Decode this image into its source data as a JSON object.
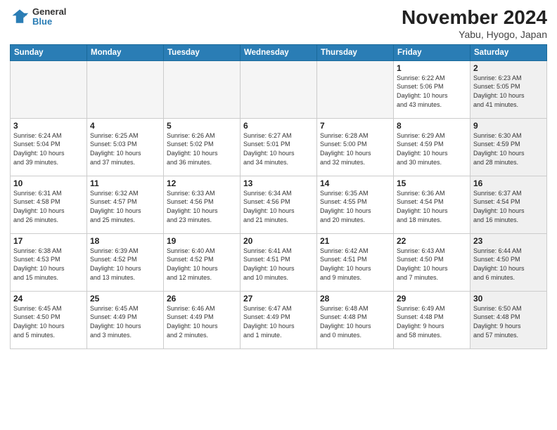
{
  "header": {
    "logo_line1": "General",
    "logo_line2": "Blue",
    "title": "November 2024",
    "subtitle": "Yabu, Hyogo, Japan"
  },
  "weekdays": [
    "Sunday",
    "Monday",
    "Tuesday",
    "Wednesday",
    "Thursday",
    "Friday",
    "Saturday"
  ],
  "weeks": [
    [
      {
        "day": "",
        "info": "",
        "empty": true
      },
      {
        "day": "",
        "info": "",
        "empty": true
      },
      {
        "day": "",
        "info": "",
        "empty": true
      },
      {
        "day": "",
        "info": "",
        "empty": true
      },
      {
        "day": "",
        "info": "",
        "empty": true
      },
      {
        "day": "1",
        "info": "Sunrise: 6:22 AM\nSunset: 5:06 PM\nDaylight: 10 hours\nand 43 minutes.",
        "shaded": false
      },
      {
        "day": "2",
        "info": "Sunrise: 6:23 AM\nSunset: 5:05 PM\nDaylight: 10 hours\nand 41 minutes.",
        "shaded": true
      }
    ],
    [
      {
        "day": "3",
        "info": "Sunrise: 6:24 AM\nSunset: 5:04 PM\nDaylight: 10 hours\nand 39 minutes.",
        "shaded": false
      },
      {
        "day": "4",
        "info": "Sunrise: 6:25 AM\nSunset: 5:03 PM\nDaylight: 10 hours\nand 37 minutes.",
        "shaded": false
      },
      {
        "day": "5",
        "info": "Sunrise: 6:26 AM\nSunset: 5:02 PM\nDaylight: 10 hours\nand 36 minutes.",
        "shaded": false
      },
      {
        "day": "6",
        "info": "Sunrise: 6:27 AM\nSunset: 5:01 PM\nDaylight: 10 hours\nand 34 minutes.",
        "shaded": false
      },
      {
        "day": "7",
        "info": "Sunrise: 6:28 AM\nSunset: 5:00 PM\nDaylight: 10 hours\nand 32 minutes.",
        "shaded": false
      },
      {
        "day": "8",
        "info": "Sunrise: 6:29 AM\nSunset: 4:59 PM\nDaylight: 10 hours\nand 30 minutes.",
        "shaded": false
      },
      {
        "day": "9",
        "info": "Sunrise: 6:30 AM\nSunset: 4:59 PM\nDaylight: 10 hours\nand 28 minutes.",
        "shaded": true
      }
    ],
    [
      {
        "day": "10",
        "info": "Sunrise: 6:31 AM\nSunset: 4:58 PM\nDaylight: 10 hours\nand 26 minutes.",
        "shaded": false
      },
      {
        "day": "11",
        "info": "Sunrise: 6:32 AM\nSunset: 4:57 PM\nDaylight: 10 hours\nand 25 minutes.",
        "shaded": false
      },
      {
        "day": "12",
        "info": "Sunrise: 6:33 AM\nSunset: 4:56 PM\nDaylight: 10 hours\nand 23 minutes.",
        "shaded": false
      },
      {
        "day": "13",
        "info": "Sunrise: 6:34 AM\nSunset: 4:56 PM\nDaylight: 10 hours\nand 21 minutes.",
        "shaded": false
      },
      {
        "day": "14",
        "info": "Sunrise: 6:35 AM\nSunset: 4:55 PM\nDaylight: 10 hours\nand 20 minutes.",
        "shaded": false
      },
      {
        "day": "15",
        "info": "Sunrise: 6:36 AM\nSunset: 4:54 PM\nDaylight: 10 hours\nand 18 minutes.",
        "shaded": false
      },
      {
        "day": "16",
        "info": "Sunrise: 6:37 AM\nSunset: 4:54 PM\nDaylight: 10 hours\nand 16 minutes.",
        "shaded": true
      }
    ],
    [
      {
        "day": "17",
        "info": "Sunrise: 6:38 AM\nSunset: 4:53 PM\nDaylight: 10 hours\nand 15 minutes.",
        "shaded": false
      },
      {
        "day": "18",
        "info": "Sunrise: 6:39 AM\nSunset: 4:52 PM\nDaylight: 10 hours\nand 13 minutes.",
        "shaded": false
      },
      {
        "day": "19",
        "info": "Sunrise: 6:40 AM\nSunset: 4:52 PM\nDaylight: 10 hours\nand 12 minutes.",
        "shaded": false
      },
      {
        "day": "20",
        "info": "Sunrise: 6:41 AM\nSunset: 4:51 PM\nDaylight: 10 hours\nand 10 minutes.",
        "shaded": false
      },
      {
        "day": "21",
        "info": "Sunrise: 6:42 AM\nSunset: 4:51 PM\nDaylight: 10 hours\nand 9 minutes.",
        "shaded": false
      },
      {
        "day": "22",
        "info": "Sunrise: 6:43 AM\nSunset: 4:50 PM\nDaylight: 10 hours\nand 7 minutes.",
        "shaded": false
      },
      {
        "day": "23",
        "info": "Sunrise: 6:44 AM\nSunset: 4:50 PM\nDaylight: 10 hours\nand 6 minutes.",
        "shaded": true
      }
    ],
    [
      {
        "day": "24",
        "info": "Sunrise: 6:45 AM\nSunset: 4:50 PM\nDaylight: 10 hours\nand 5 minutes.",
        "shaded": false
      },
      {
        "day": "25",
        "info": "Sunrise: 6:45 AM\nSunset: 4:49 PM\nDaylight: 10 hours\nand 3 minutes.",
        "shaded": false
      },
      {
        "day": "26",
        "info": "Sunrise: 6:46 AM\nSunset: 4:49 PM\nDaylight: 10 hours\nand 2 minutes.",
        "shaded": false
      },
      {
        "day": "27",
        "info": "Sunrise: 6:47 AM\nSunset: 4:49 PM\nDaylight: 10 hours\nand 1 minute.",
        "shaded": false
      },
      {
        "day": "28",
        "info": "Sunrise: 6:48 AM\nSunset: 4:48 PM\nDaylight: 10 hours\nand 0 minutes.",
        "shaded": false
      },
      {
        "day": "29",
        "info": "Sunrise: 6:49 AM\nSunset: 4:48 PM\nDaylight: 9 hours\nand 58 minutes.",
        "shaded": false
      },
      {
        "day": "30",
        "info": "Sunrise: 6:50 AM\nSunset: 4:48 PM\nDaylight: 9 hours\nand 57 minutes.",
        "shaded": true
      }
    ]
  ]
}
